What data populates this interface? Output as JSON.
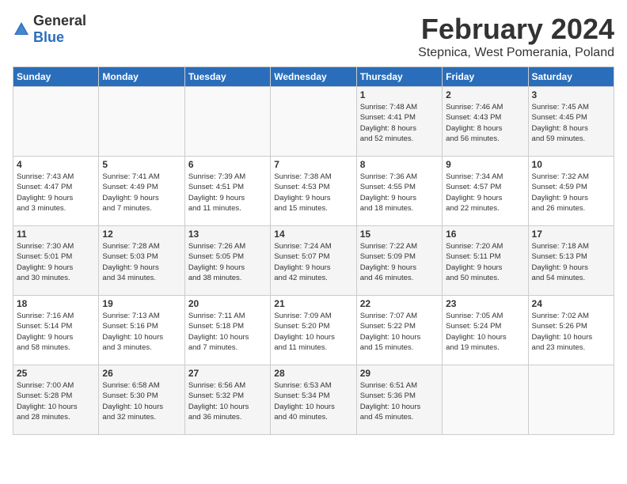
{
  "header": {
    "logo_general": "General",
    "logo_blue": "Blue",
    "month": "February 2024",
    "location": "Stepnica, West Pomerania, Poland"
  },
  "weekdays": [
    "Sunday",
    "Monday",
    "Tuesday",
    "Wednesday",
    "Thursday",
    "Friday",
    "Saturday"
  ],
  "weeks": [
    [
      {
        "day": "",
        "info": ""
      },
      {
        "day": "",
        "info": ""
      },
      {
        "day": "",
        "info": ""
      },
      {
        "day": "",
        "info": ""
      },
      {
        "day": "1",
        "info": "Sunrise: 7:48 AM\nSunset: 4:41 PM\nDaylight: 8 hours\nand 52 minutes."
      },
      {
        "day": "2",
        "info": "Sunrise: 7:46 AM\nSunset: 4:43 PM\nDaylight: 8 hours\nand 56 minutes."
      },
      {
        "day": "3",
        "info": "Sunrise: 7:45 AM\nSunset: 4:45 PM\nDaylight: 8 hours\nand 59 minutes."
      }
    ],
    [
      {
        "day": "4",
        "info": "Sunrise: 7:43 AM\nSunset: 4:47 PM\nDaylight: 9 hours\nand 3 minutes."
      },
      {
        "day": "5",
        "info": "Sunrise: 7:41 AM\nSunset: 4:49 PM\nDaylight: 9 hours\nand 7 minutes."
      },
      {
        "day": "6",
        "info": "Sunrise: 7:39 AM\nSunset: 4:51 PM\nDaylight: 9 hours\nand 11 minutes."
      },
      {
        "day": "7",
        "info": "Sunrise: 7:38 AM\nSunset: 4:53 PM\nDaylight: 9 hours\nand 15 minutes."
      },
      {
        "day": "8",
        "info": "Sunrise: 7:36 AM\nSunset: 4:55 PM\nDaylight: 9 hours\nand 18 minutes."
      },
      {
        "day": "9",
        "info": "Sunrise: 7:34 AM\nSunset: 4:57 PM\nDaylight: 9 hours\nand 22 minutes."
      },
      {
        "day": "10",
        "info": "Sunrise: 7:32 AM\nSunset: 4:59 PM\nDaylight: 9 hours\nand 26 minutes."
      }
    ],
    [
      {
        "day": "11",
        "info": "Sunrise: 7:30 AM\nSunset: 5:01 PM\nDaylight: 9 hours\nand 30 minutes."
      },
      {
        "day": "12",
        "info": "Sunrise: 7:28 AM\nSunset: 5:03 PM\nDaylight: 9 hours\nand 34 minutes."
      },
      {
        "day": "13",
        "info": "Sunrise: 7:26 AM\nSunset: 5:05 PM\nDaylight: 9 hours\nand 38 minutes."
      },
      {
        "day": "14",
        "info": "Sunrise: 7:24 AM\nSunset: 5:07 PM\nDaylight: 9 hours\nand 42 minutes."
      },
      {
        "day": "15",
        "info": "Sunrise: 7:22 AM\nSunset: 5:09 PM\nDaylight: 9 hours\nand 46 minutes."
      },
      {
        "day": "16",
        "info": "Sunrise: 7:20 AM\nSunset: 5:11 PM\nDaylight: 9 hours\nand 50 minutes."
      },
      {
        "day": "17",
        "info": "Sunrise: 7:18 AM\nSunset: 5:13 PM\nDaylight: 9 hours\nand 54 minutes."
      }
    ],
    [
      {
        "day": "18",
        "info": "Sunrise: 7:16 AM\nSunset: 5:14 PM\nDaylight: 9 hours\nand 58 minutes."
      },
      {
        "day": "19",
        "info": "Sunrise: 7:13 AM\nSunset: 5:16 PM\nDaylight: 10 hours\nand 3 minutes."
      },
      {
        "day": "20",
        "info": "Sunrise: 7:11 AM\nSunset: 5:18 PM\nDaylight: 10 hours\nand 7 minutes."
      },
      {
        "day": "21",
        "info": "Sunrise: 7:09 AM\nSunset: 5:20 PM\nDaylight: 10 hours\nand 11 minutes."
      },
      {
        "day": "22",
        "info": "Sunrise: 7:07 AM\nSunset: 5:22 PM\nDaylight: 10 hours\nand 15 minutes."
      },
      {
        "day": "23",
        "info": "Sunrise: 7:05 AM\nSunset: 5:24 PM\nDaylight: 10 hours\nand 19 minutes."
      },
      {
        "day": "24",
        "info": "Sunrise: 7:02 AM\nSunset: 5:26 PM\nDaylight: 10 hours\nand 23 minutes."
      }
    ],
    [
      {
        "day": "25",
        "info": "Sunrise: 7:00 AM\nSunset: 5:28 PM\nDaylight: 10 hours\nand 28 minutes."
      },
      {
        "day": "26",
        "info": "Sunrise: 6:58 AM\nSunset: 5:30 PM\nDaylight: 10 hours\nand 32 minutes."
      },
      {
        "day": "27",
        "info": "Sunrise: 6:56 AM\nSunset: 5:32 PM\nDaylight: 10 hours\nand 36 minutes."
      },
      {
        "day": "28",
        "info": "Sunrise: 6:53 AM\nSunset: 5:34 PM\nDaylight: 10 hours\nand 40 minutes."
      },
      {
        "day": "29",
        "info": "Sunrise: 6:51 AM\nSunset: 5:36 PM\nDaylight: 10 hours\nand 45 minutes."
      },
      {
        "day": "",
        "info": ""
      },
      {
        "day": "",
        "info": ""
      }
    ]
  ]
}
